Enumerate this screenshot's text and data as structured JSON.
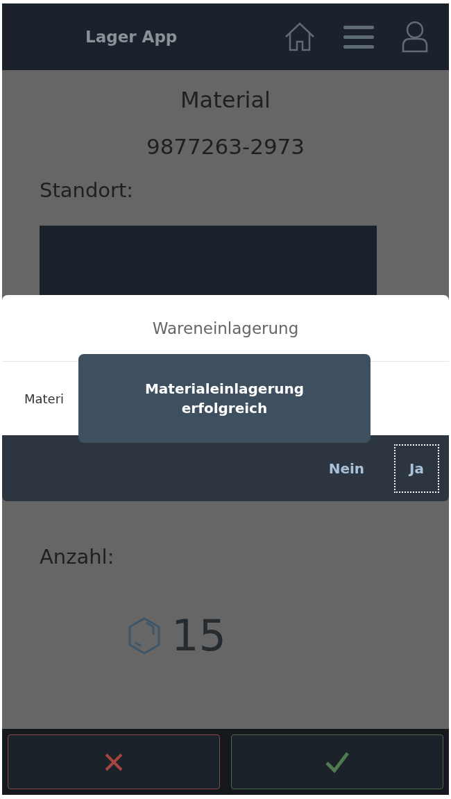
{
  "header": {
    "title": "Lager App"
  },
  "page": {
    "heading": "Material",
    "material_number": "9877263-2973",
    "location_label": "Standort:",
    "quantity_label": "Anzahl:",
    "quantity": "15"
  },
  "dialog": {
    "title": "Wareneinlagerung",
    "message": "Materi",
    "buttons": [
      {
        "label": "Nein",
        "focused": false
      },
      {
        "label": "Ja",
        "focused": true
      }
    ]
  },
  "toast": {
    "message": "Materialeinlagerung erfolgreich"
  },
  "actions": [
    {
      "kind": "cancel"
    },
    {
      "kind": "confirm"
    }
  ]
}
